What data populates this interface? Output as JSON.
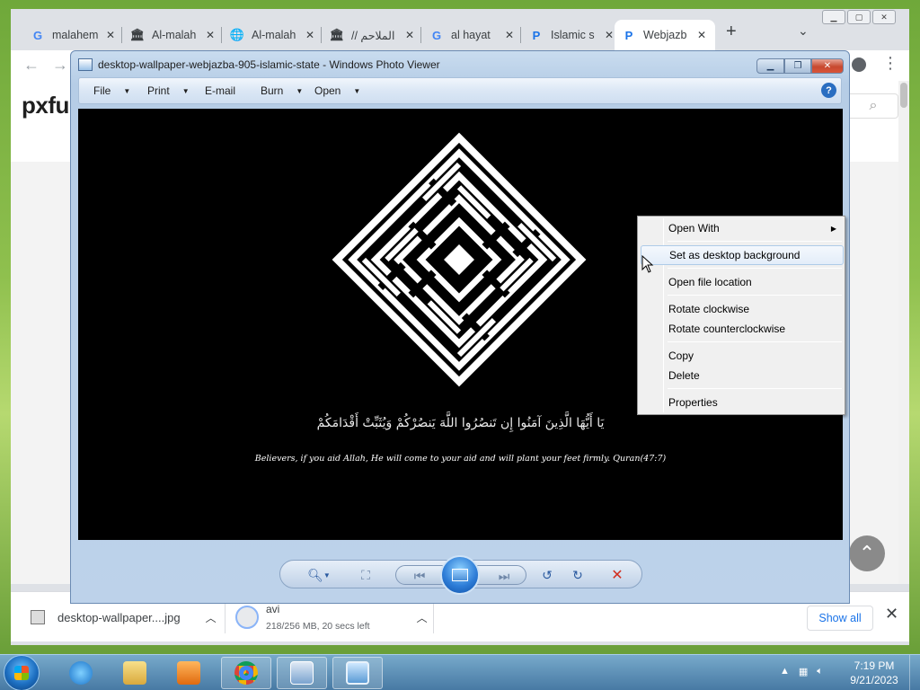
{
  "chrome": {
    "tabs": [
      {
        "label": "malahem",
        "icon": "google-icon"
      },
      {
        "label": "Al-malah",
        "icon": "institution-icon"
      },
      {
        "label": "Al-malah",
        "icon": "globe-icon"
      },
      {
        "label": "// الملاحم",
        "icon": "institution-icon"
      },
      {
        "label": "al hayat",
        "icon": "google-icon"
      },
      {
        "label": "Islamic s",
        "icon": "pxfuel-icon"
      },
      {
        "label": "Webjazb",
        "icon": "pxfuel-icon"
      }
    ],
    "new_tab": "+",
    "site_logo": "pxfu",
    "downloads": [
      {
        "name": "desktop-wallpaper....jpg"
      },
      {
        "name": "avi",
        "status": "218/256 MB, 20 secs left"
      }
    ],
    "show_all": "Show all"
  },
  "viewer": {
    "title": "desktop-wallpaper-webjazba-905-islamic-state - Windows Photo Viewer",
    "menu": {
      "file": "File",
      "print": "Print",
      "email": "E-mail",
      "burn": "Burn",
      "open": "Open"
    },
    "help": "?",
    "image_text": {
      "arabic": "يَا أَيُّهَا الَّذِينَ آمَنُوا إِن تَنصُرُوا اللَّهَ يَنصُرْكُمْ وَيُثَبِّتْ أَقْدَامَكُمْ",
      "english": "Believers, if you aid Allah, He will come to your aid and will plant your feet firmly. Quran(47:7)"
    }
  },
  "context_menu": {
    "open_with": "Open With",
    "set_desktop": "Set as desktop background",
    "open_location": "Open file location",
    "rotate_cw": "Rotate clockwise",
    "rotate_ccw": "Rotate counterclockwise",
    "copy": "Copy",
    "delete": "Delete",
    "properties": "Properties"
  },
  "taskbar": {
    "time": "7:19 PM",
    "date": "9/21/2023"
  },
  "colors": {
    "viewer_chrome": "#bdd2ea",
    "close_red": "#c7492f",
    "link_blue": "#1a73e8"
  }
}
